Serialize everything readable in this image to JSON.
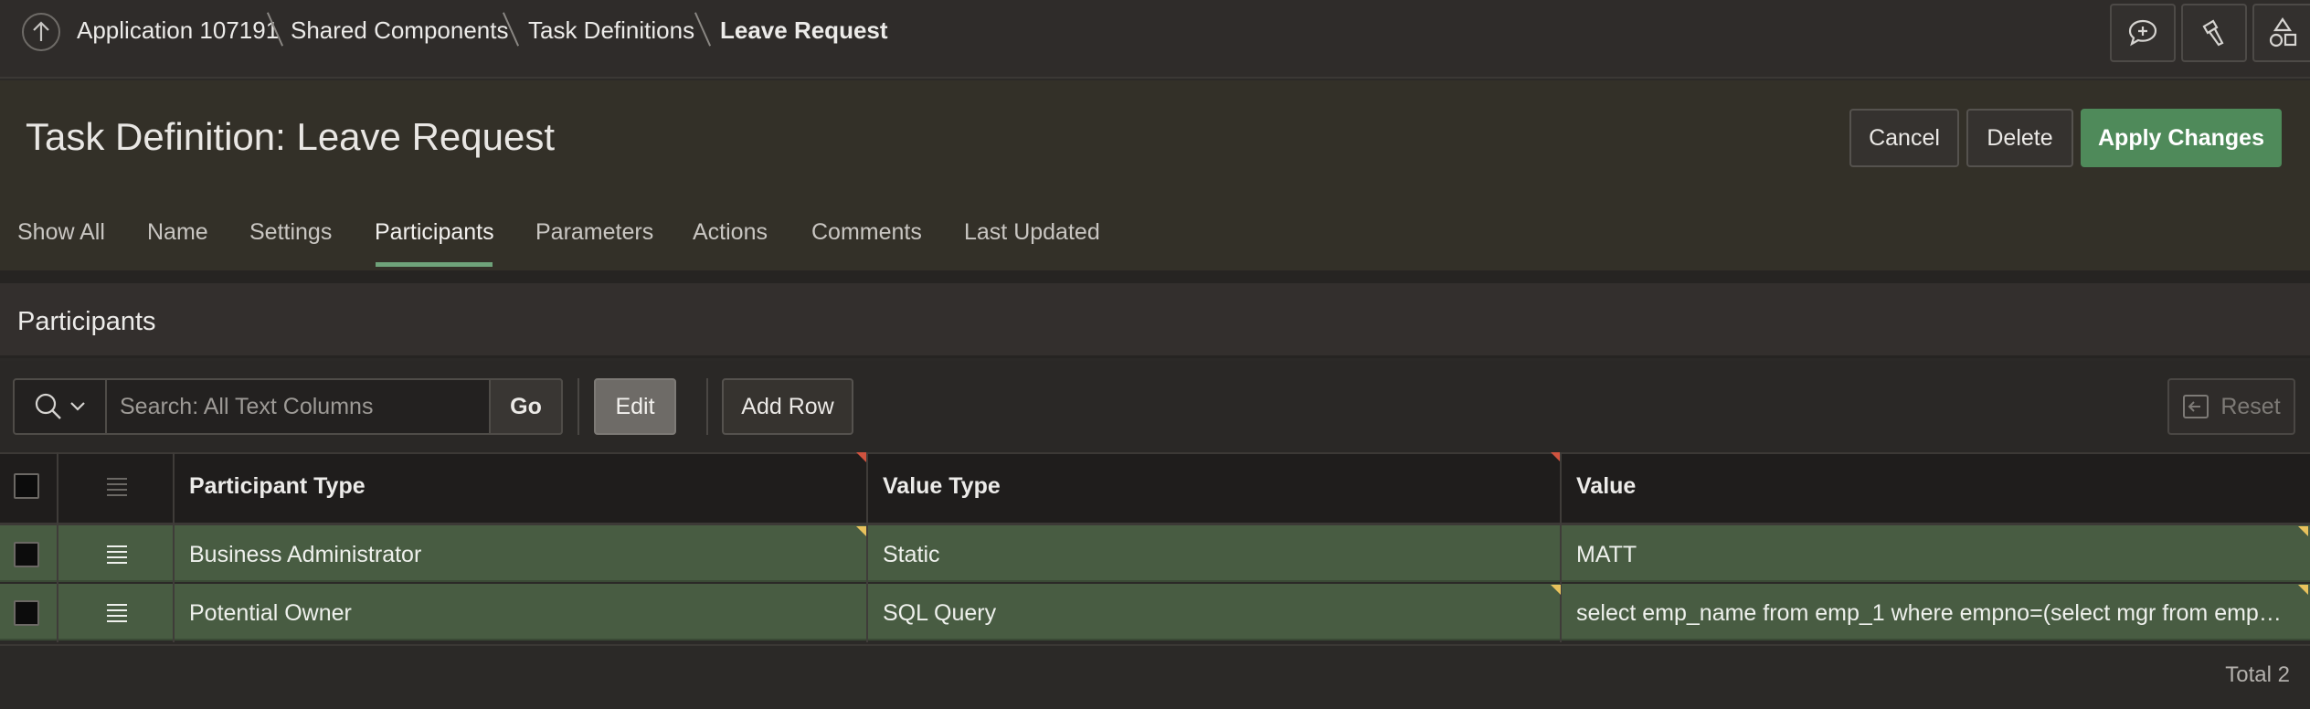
{
  "breadcrumb": {
    "items": [
      {
        "label": "Application 107191"
      },
      {
        "label": "Shared Components"
      },
      {
        "label": "Task Definitions"
      },
      {
        "label": "Leave Request"
      }
    ]
  },
  "toolbar_icons": [
    "comment-add-icon",
    "flashlight-icon",
    "shapes-icon"
  ],
  "page": {
    "title": "Task Definition: Leave Request",
    "buttons": {
      "cancel": "Cancel",
      "delete": "Delete",
      "apply": "Apply Changes"
    }
  },
  "tabs": [
    {
      "label": "Show All"
    },
    {
      "label": "Name"
    },
    {
      "label": "Settings"
    },
    {
      "label": "Participants",
      "active": true
    },
    {
      "label": "Parameters"
    },
    {
      "label": "Actions"
    },
    {
      "label": "Comments"
    },
    {
      "label": "Last Updated"
    }
  ],
  "region": {
    "title": "Participants",
    "search": {
      "placeholder": "Search: All Text Columns",
      "value": "",
      "go_label": "Go"
    },
    "edit_label": "Edit",
    "add_row_label": "Add Row",
    "reset_label": "Reset",
    "columns": [
      "Participant Type",
      "Value Type",
      "Value"
    ],
    "rows": [
      {
        "participant_type": "Business Administrator",
        "value_type": "Static",
        "value": "MATT"
      },
      {
        "participant_type": "Potential Owner",
        "value_type": "SQL Query",
        "value": "select emp_name from emp_1 where empno=(select mgr from emp_1 …"
      }
    ],
    "total": "Total 2"
  },
  "colors": {
    "accent_green": "#4f8a5a",
    "row_selected": "#485c42",
    "tab_active": "#6fa37a"
  }
}
